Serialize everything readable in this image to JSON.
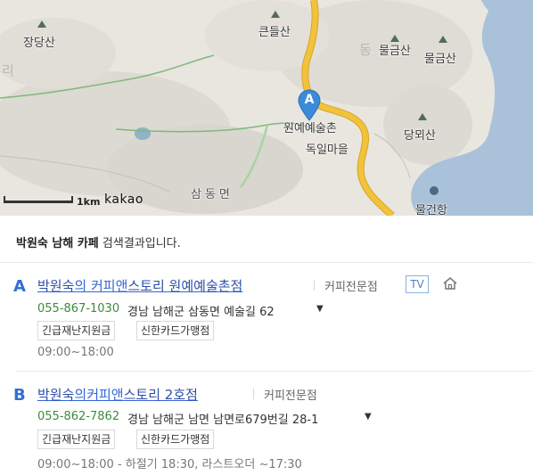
{
  "map": {
    "labels": {
      "jangdangsan": "장당산",
      "keundeulsan": "큰들산",
      "dong": "동",
      "mulgeumsan_1": "물금산",
      "mulgeumsan_2": "물금산",
      "ri": "리",
      "wonye": "원예예술촌",
      "dogil": "독일마을",
      "dangmoesan": "당뫼산",
      "samdong": "삼동면",
      "mulgeonhang": "물건항"
    },
    "marker_letter": "A",
    "scale_label": "1km",
    "brand": "kakao"
  },
  "summary": {
    "query": "박원숙 남해 카페",
    "suffix": " 검색결과입니다."
  },
  "results": [
    {
      "letter": "A",
      "name_part1": "박원숙",
      "name_part2": "의 커피앤",
      "name_part3": "스토리 원예예술촌점",
      "category": "커피전문점",
      "tv_badge": "TV",
      "phone": "055-867-1030",
      "address": "경남 남해군 삼동면 예술길 62",
      "tags": [
        "긴급재난지원금",
        "신한카드가맹점"
      ],
      "hours": "09:00~18:00"
    },
    {
      "letter": "B",
      "name_part1": "박원숙",
      "name_part2": "의커피앤",
      "name_part3": "스토리 2호점",
      "category": "커피전문점",
      "phone": "055-862-7862",
      "address": "경남 남해군 남면 남면로679번길 28-1",
      "tags": [
        "긴급재난지원금",
        "신한카드가맹점"
      ],
      "hours": "09:00~18:00 - 하절기 18:30, 라스트오더 ~17:30"
    }
  ],
  "colors": {
    "link_blue": "#3367d6",
    "letter_blue": "#2f6fd6",
    "phone_green": "#3d8a3d",
    "road_yellow": "#f2c23a",
    "sea_blue": "#a9c2d9"
  }
}
